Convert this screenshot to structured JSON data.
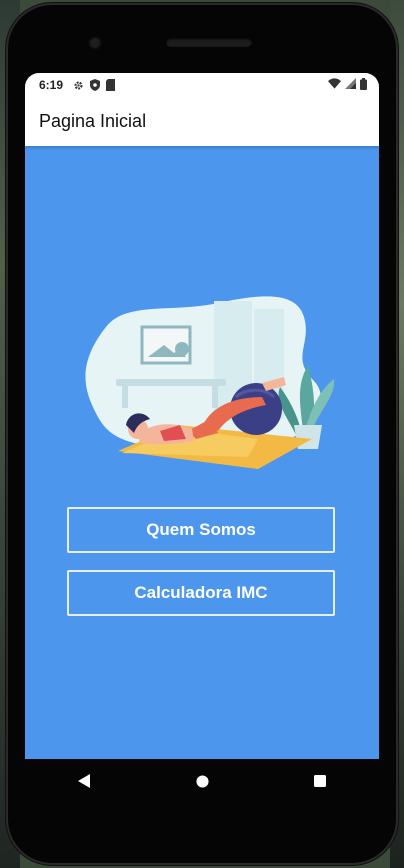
{
  "statusbar": {
    "time": "6:19",
    "icons_left": [
      "gear-icon",
      "shield-icon",
      "sim-card-icon"
    ],
    "icons_right": [
      "wifi-icon",
      "signal-icon",
      "battery-icon"
    ]
  },
  "appbar": {
    "title": "Pagina Inicial"
  },
  "buttons": {
    "about": "Quem Somos",
    "imc": "Calculadora IMC"
  },
  "navbar": {
    "items": [
      "back-icon",
      "home-icon",
      "recents-icon"
    ]
  },
  "colors": {
    "screen_background": "#4c96ee",
    "appbar_background": "#ffffff",
    "button_border": "#e6efff"
  }
}
